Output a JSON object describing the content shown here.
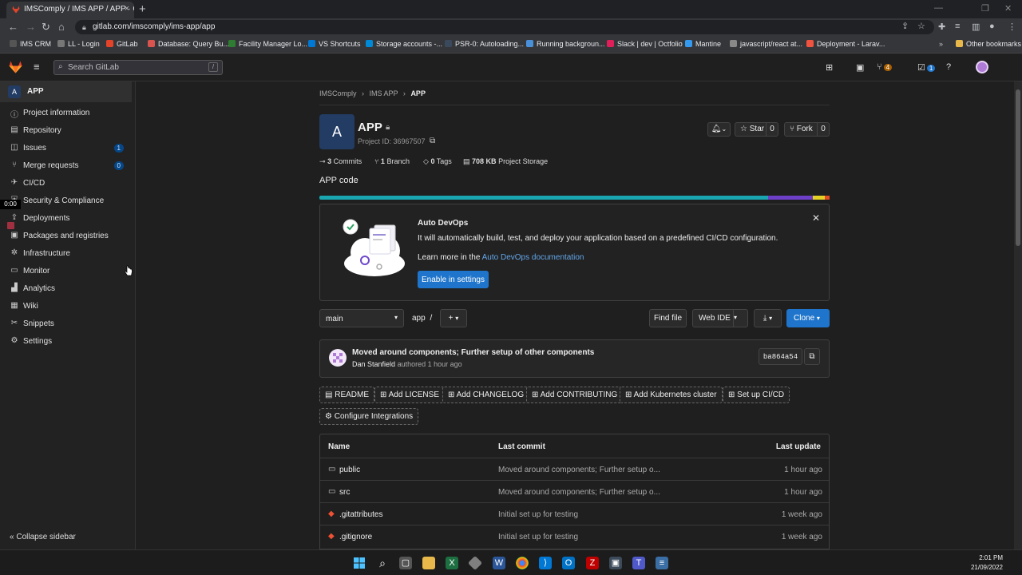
{
  "browser": {
    "tab_title": "IMSComply / IMS APP / APP · Git",
    "url": "gitlab.com/imscomply/ims-app/app",
    "bookmarks": [
      {
        "label": "IMS CRM",
        "color": "#555"
      },
      {
        "label": "LL - Login",
        "color": "#777"
      },
      {
        "label": "GitLab",
        "color": "#e24329"
      },
      {
        "label": "Database: Query Bu...",
        "color": "#d9534f"
      },
      {
        "label": "Facility Manager Lo...",
        "color": "#2e7d32"
      },
      {
        "label": "VS Shortcuts",
        "color": "#0078d4"
      },
      {
        "label": "Storage accounts -...",
        "color": "#0089d6"
      },
      {
        "label": "PSR-0: Autoloading...",
        "color": "#3a4a5c"
      },
      {
        "label": "Running backgroun...",
        "color": "#4a90d9"
      },
      {
        "label": "Slack | dev | Octfolio",
        "color": "#e01e5a"
      },
      {
        "label": "Mantine",
        "color": "#339af0"
      },
      {
        "label": "javascript/react at...",
        "color": "#333"
      },
      {
        "label": "Deployment - Larav...",
        "color": "#f05340"
      }
    ],
    "other_bookmarks": "Other bookmarks"
  },
  "header": {
    "search_placeholder": "Search GitLab",
    "search_shortcut": "/",
    "mr_count": "4",
    "todo_count": "1"
  },
  "sidebar": {
    "project_letter": "A",
    "project_name": "APP",
    "items": [
      {
        "label": "Project information",
        "icon": "info-icon",
        "glyph": "ⓘ"
      },
      {
        "label": "Repository",
        "icon": "book-icon",
        "glyph": "▤"
      },
      {
        "label": "Issues",
        "icon": "issues-icon",
        "glyph": "◫",
        "count": "1"
      },
      {
        "label": "Merge requests",
        "icon": "merge-request-icon",
        "glyph": "⑂",
        "count": "0"
      },
      {
        "label": "CI/CD",
        "icon": "rocket-icon",
        "glyph": "✈"
      },
      {
        "label": "Security & Compliance",
        "icon": "shield-icon",
        "glyph": "⛨"
      },
      {
        "label": "Deployments",
        "icon": "deployments-icon",
        "glyph": "⇪"
      },
      {
        "label": "Packages and registries",
        "icon": "package-icon",
        "glyph": "▣"
      },
      {
        "label": "Infrastructure",
        "icon": "cloud-gear-icon",
        "glyph": "✲"
      },
      {
        "label": "Monitor",
        "icon": "monitor-icon",
        "glyph": "▭"
      },
      {
        "label": "Analytics",
        "icon": "chart-icon",
        "glyph": "▟"
      },
      {
        "label": "Wiki",
        "icon": "wiki-icon",
        "glyph": "▦"
      },
      {
        "label": "Snippets",
        "icon": "scissors-icon",
        "glyph": "✂"
      },
      {
        "label": "Settings",
        "icon": "gear-icon",
        "glyph": "⚙"
      }
    ],
    "collapse_label": "Collapse sidebar",
    "timer": "0:00"
  },
  "breadcrumb": [
    "IMSComply",
    "IMS APP",
    "APP"
  ],
  "project": {
    "avatar_letter": "A",
    "title": "APP",
    "project_id": "Project ID: 36967507",
    "star_label": "Star",
    "star_count": "0",
    "fork_label": "Fork",
    "fork_count": "0",
    "stats": [
      {
        "num": "3",
        "label": "Commits"
      },
      {
        "num": "1",
        "label": "Branch"
      },
      {
        "num": "0",
        "label": "Tags"
      },
      {
        "num": "708 KB",
        "label": "Project Storage"
      }
    ],
    "description": "APP code",
    "language_bar": [
      {
        "share": 0.88,
        "color": "#1aa6b0"
      },
      {
        "share": 0.087,
        "color": "#6e40c9"
      },
      {
        "share": 0.023,
        "color": "#e5d024"
      },
      {
        "share": 0.01,
        "color": "#e34c26"
      }
    ]
  },
  "devops": {
    "title": "Auto DevOps",
    "body": "It will automatically build, test, and deploy your application based on a predefined CI/CD configuration.",
    "learn_prefix": "Learn more in the",
    "learn_link": "Auto DevOps documentation",
    "button": "Enable in settings"
  },
  "repo_toolbar": {
    "branch": "main",
    "path": "app",
    "path_sep": "/",
    "find_file": "Find file",
    "web_ide": "Web IDE",
    "clone": "Clone"
  },
  "last_commit": {
    "message": "Moved around components; Further setup of other components",
    "author": "Dan Stanfield",
    "authored": "authored",
    "time": "1 hour ago",
    "sha": "ba864a54"
  },
  "quick_actions": [
    "README",
    "Add LICENSE",
    "Add CHANGELOG",
    "Add CONTRIBUTING",
    "Add Kubernetes cluster",
    "Set up CI/CD",
    "Configure Integrations"
  ],
  "files": {
    "headers": {
      "name": "Name",
      "commit": "Last commit",
      "update": "Last update"
    },
    "rows": [
      {
        "name": "public",
        "type": "folder",
        "commit": "Moved around components; Further setup o...",
        "update": "1 hour ago"
      },
      {
        "name": "src",
        "type": "folder",
        "commit": "Moved around components; Further setup o...",
        "update": "1 hour ago"
      },
      {
        "name": ".gitattributes",
        "type": "git",
        "commit": "Initial set up for testing",
        "update": "1 week ago"
      },
      {
        "name": ".gitignore",
        "type": "git",
        "commit": "Initial set up for testing",
        "update": "1 week ago"
      }
    ]
  },
  "taskbar": {
    "time": "2:01 PM",
    "date": "21/09/2022"
  }
}
